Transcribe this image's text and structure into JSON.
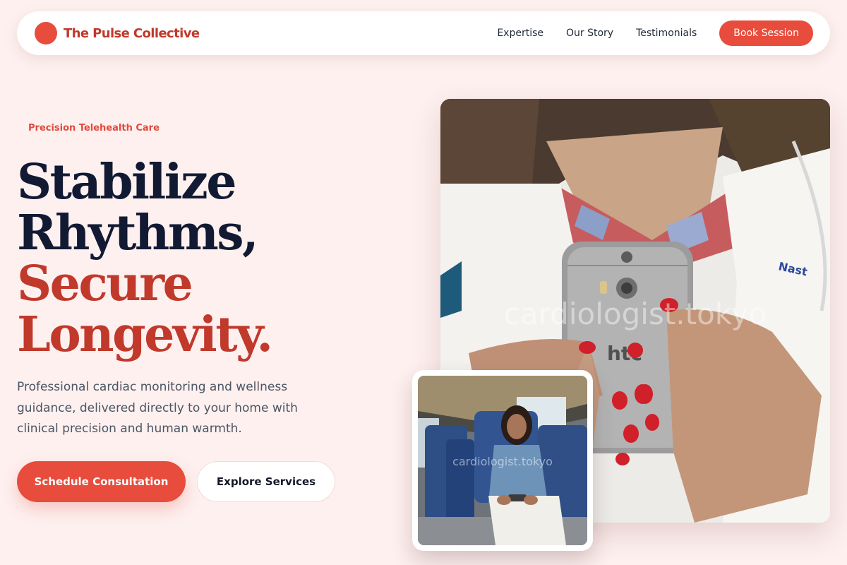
{
  "brand": {
    "name": "The Pulse Collective",
    "accent": "#e74c3c",
    "brand_text": "#c0392b"
  },
  "nav": {
    "links": [
      "Expertise",
      "Our Story",
      "Testimonials"
    ],
    "cta": "Book Session"
  },
  "hero": {
    "eyebrow": "Precision Telehealth Care",
    "headline": [
      "Stabilize",
      "Rhythms,",
      "Secure",
      "Longevity."
    ],
    "description": "Professional cardiac monitoring and wellness guidance, delivered directly to your home with clinical precision and human warmth.",
    "primary_cta": "Schedule Consultation",
    "secondary_cta": "Explore Services"
  },
  "images": {
    "main_watermark": "cardiologist.tokyo",
    "inset_watermark": "cardiologist.tokyo",
    "phone_brand": "htc",
    "coat_text": "Nast"
  }
}
